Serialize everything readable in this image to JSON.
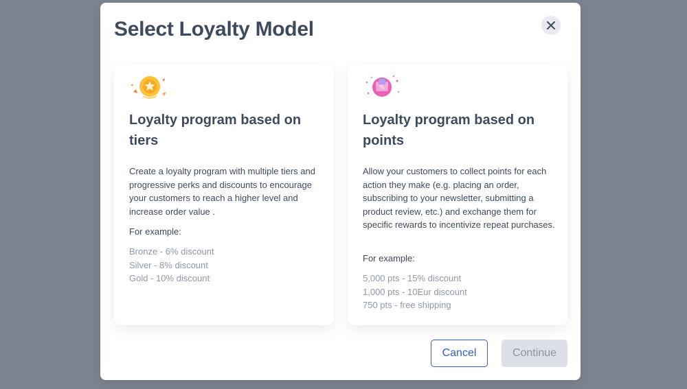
{
  "modal": {
    "title": "Select Loyalty Model"
  },
  "cards": [
    {
      "title": "Loyalty program based on tiers",
      "description": "Create a loyalty program with multiple tiers and progressive perks and discounts to encourage your customers to reach a higher level and increase order value .",
      "example_label": "For example:",
      "examples": [
        "Bronze - 6% discount",
        "Silver - 8% discount",
        "Gold - 10% discount"
      ],
      "icon": "gold-medal-icon"
    },
    {
      "title": "Loyalty program based on points",
      "description": "Allow your customers to collect points for each action they make (e.g. placing an order, subscribing to your newsletter, submitting a product review, etc.) and exchange them for specific rewards to incentivize repeat purchases.",
      "example_label": "For example:",
      "examples": [
        "5,000 pts - 15% discount",
        "1,000 pts - 10Eur discount",
        "750 pts - free shipping"
      ],
      "icon": "gift-coupon-icon"
    }
  ],
  "footer": {
    "cancel_label": "Cancel",
    "continue_label": "Continue"
  },
  "colors": {
    "backdrop": "#7d8491",
    "primary": "#2e5bd8",
    "disabled_bg": "#dde0e6",
    "muted_text": "#8f98a6",
    "heading": "#3f4a5d"
  }
}
